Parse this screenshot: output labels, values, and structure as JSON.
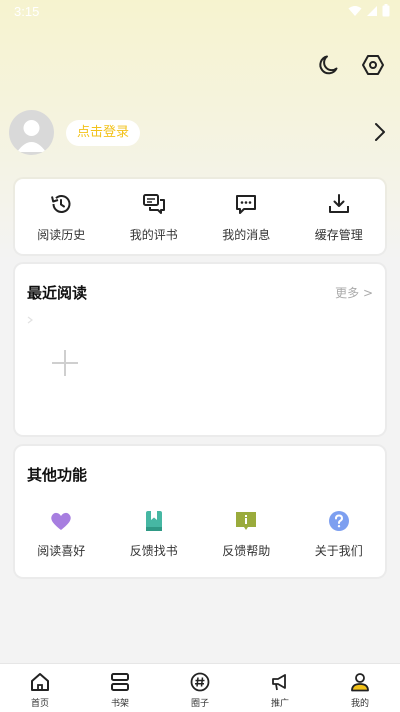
{
  "status": {
    "time": "3:15"
  },
  "profile": {
    "login_label": "点击登录"
  },
  "quick": [
    {
      "label": "阅读历史",
      "icon": "history-icon"
    },
    {
      "label": "我的评书",
      "icon": "comments-icon"
    },
    {
      "label": "我的消息",
      "icon": "message-icon"
    },
    {
      "label": "缓存管理",
      "icon": "download-icon"
    }
  ],
  "recent": {
    "title": "最近阅读",
    "more": "更多 >"
  },
  "other": {
    "title": "其他功能",
    "items": [
      {
        "label": "阅读喜好",
        "icon": "heart-icon",
        "color": "#a77ee0"
      },
      {
        "label": "反馈找书",
        "icon": "bookmark-book-icon",
        "color": "#46b7a3"
      },
      {
        "label": "反馈帮助",
        "icon": "info-board-icon",
        "color": "#9aab3c"
      },
      {
        "label": "关于我们",
        "icon": "question-icon",
        "color": "#7d9ff0"
      }
    ]
  },
  "tabs": [
    {
      "label": "首页",
      "icon": "home-icon"
    },
    {
      "label": "书架",
      "icon": "bookshelf-icon"
    },
    {
      "label": "圈子",
      "icon": "hashtag-icon"
    },
    {
      "label": "推广",
      "icon": "megaphone-icon"
    },
    {
      "label": "我的",
      "icon": "person-icon",
      "active": true
    }
  ],
  "colors": {
    "accent": "#f2c21a",
    "background": "#f3f3f3"
  }
}
